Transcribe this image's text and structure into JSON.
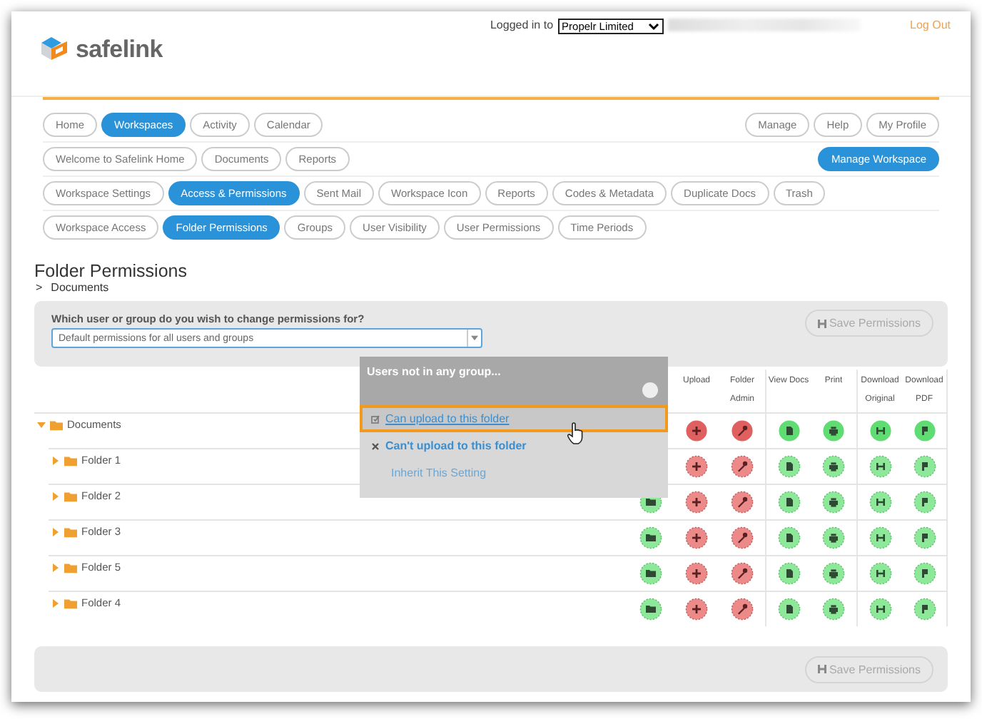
{
  "header": {
    "logo": "safelink",
    "login_label": "Logged in to",
    "account_select": "Propelr Limited",
    "logout": "Log Out"
  },
  "nav_rows": [
    {
      "left": [
        {
          "label": "Home",
          "selected": false
        },
        {
          "label": "Workspaces",
          "selected": true
        },
        {
          "label": "Activity",
          "selected": false
        },
        {
          "label": "Calendar",
          "selected": false
        }
      ],
      "right": [
        {
          "label": "Manage",
          "selected": false
        },
        {
          "label": "Help",
          "selected": false
        },
        {
          "label": "My Profile",
          "selected": false
        }
      ]
    },
    {
      "left": [
        {
          "label": "Welcome to Safelink Home",
          "selected": false
        },
        {
          "label": "Documents",
          "selected": false
        },
        {
          "label": "Reports",
          "selected": false
        }
      ],
      "right": [
        {
          "label": "Manage Workspace",
          "selected": true
        }
      ]
    },
    {
      "left": [
        {
          "label": "Workspace Settings",
          "selected": false
        },
        {
          "label": "Access & Permissions",
          "selected": true
        },
        {
          "label": "Sent Mail",
          "selected": false
        },
        {
          "label": "Workspace Icon",
          "selected": false
        },
        {
          "label": "Reports",
          "selected": false
        },
        {
          "label": "Codes & Metadata",
          "selected": false
        },
        {
          "label": "Duplicate Docs",
          "selected": false
        },
        {
          "label": "Trash",
          "selected": false
        }
      ],
      "right": []
    },
    {
      "left": [
        {
          "label": "Workspace Access",
          "selected": false
        },
        {
          "label": "Folder Permissions",
          "selected": true
        },
        {
          "label": "Groups",
          "selected": false
        },
        {
          "label": "User Visibility",
          "selected": false
        },
        {
          "label": "User Permissions",
          "selected": false
        },
        {
          "label": "Time Periods",
          "selected": false
        }
      ],
      "right": []
    }
  ],
  "page": {
    "title": "Folder Permissions",
    "breadcrumb_sep": ">",
    "breadcrumb": "Documents"
  },
  "selector": {
    "question": "Which user or group do you wish to change permissions for?",
    "value": "Default permissions for all users and groups",
    "save_button": "Save Permissions",
    "save_disabled": true
  },
  "table": {
    "columns": [
      {
        "kind": "folder"
      },
      {
        "label": "Upload",
        "kind": "plus"
      },
      {
        "label": "Folder Admin",
        "kind": "wrench"
      },
      {
        "label": "View Docs",
        "kind": "doc"
      },
      {
        "label": "Print",
        "kind": "printer"
      },
      {
        "label": "Download Original",
        "kind": "download"
      },
      {
        "label": "Download PDF",
        "kind": "pdf"
      }
    ],
    "rows": [
      {
        "name": "Documents",
        "expanded": true,
        "cells": [
          null,
          {
            "allowed": false,
            "inherited": false
          },
          {
            "allowed": false,
            "inherited": false
          },
          {
            "allowed": true,
            "inherited": false
          },
          {
            "allowed": true,
            "inherited": false
          },
          {
            "allowed": true,
            "inherited": false
          },
          {
            "allowed": true,
            "inherited": false
          }
        ],
        "children": [
          {
            "name": "Folder 1",
            "expanded": false,
            "cells": [
              null,
              {
                "allowed": false,
                "inherited": true
              },
              {
                "allowed": false,
                "inherited": true
              },
              {
                "allowed": true,
                "inherited": true
              },
              {
                "allowed": true,
                "inherited": true
              },
              {
                "allowed": true,
                "inherited": true
              },
              {
                "allowed": true,
                "inherited": true
              }
            ]
          },
          {
            "name": "Folder 2",
            "expanded": false,
            "cells": [
              {
                "allowed": true,
                "inherited": true
              },
              {
                "allowed": false,
                "inherited": true
              },
              {
                "allowed": false,
                "inherited": true
              },
              {
                "allowed": true,
                "inherited": true
              },
              {
                "allowed": true,
                "inherited": true
              },
              {
                "allowed": true,
                "inherited": true
              },
              {
                "allowed": true,
                "inherited": true
              }
            ]
          },
          {
            "name": "Folder 3",
            "expanded": false,
            "cells": [
              {
                "allowed": true,
                "inherited": true
              },
              {
                "allowed": false,
                "inherited": true
              },
              {
                "allowed": false,
                "inherited": true
              },
              {
                "allowed": true,
                "inherited": true
              },
              {
                "allowed": true,
                "inherited": true
              },
              {
                "allowed": true,
                "inherited": true
              },
              {
                "allowed": true,
                "inherited": true
              }
            ]
          },
          {
            "name": "Folder 5",
            "expanded": false,
            "cells": [
              {
                "allowed": true,
                "inherited": true
              },
              {
                "allowed": false,
                "inherited": true
              },
              {
                "allowed": false,
                "inherited": true
              },
              {
                "allowed": true,
                "inherited": true
              },
              {
                "allowed": true,
                "inherited": true
              },
              {
                "allowed": true,
                "inherited": true
              },
              {
                "allowed": true,
                "inherited": true
              }
            ]
          },
          {
            "name": "Folder 4",
            "expanded": false,
            "cells": [
              {
                "allowed": true,
                "inherited": true
              },
              {
                "allowed": false,
                "inherited": true
              },
              {
                "allowed": false,
                "inherited": true
              },
              {
                "allowed": true,
                "inherited": true
              },
              {
                "allowed": true,
                "inherited": true
              },
              {
                "allowed": true,
                "inherited": true
              },
              {
                "allowed": true,
                "inherited": true
              }
            ]
          }
        ]
      }
    ]
  },
  "popup": {
    "title": "Users not in any group...",
    "options": [
      {
        "label": "Can upload to this folder",
        "kind": "allow",
        "selected": true
      },
      {
        "label": "Can't upload to this folder",
        "kind": "deny",
        "selected": false
      },
      {
        "label": "Inherit This Setting",
        "kind": "inherit",
        "selected": false
      }
    ]
  },
  "footer": {
    "save_button": "Save Permissions",
    "save_disabled": true
  }
}
